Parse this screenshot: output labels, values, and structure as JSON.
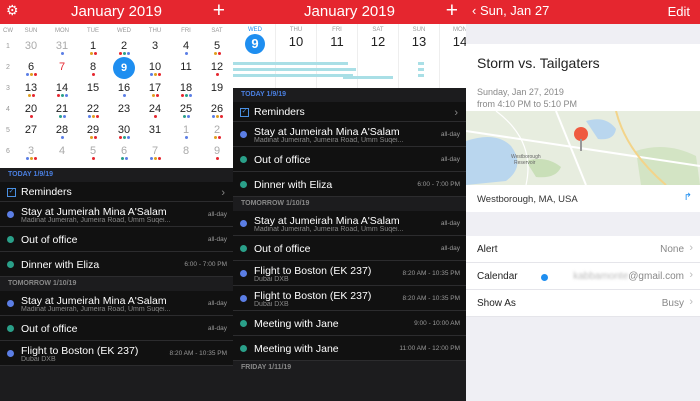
{
  "panel1": {
    "header": {
      "title": "January 2019",
      "settings_icon": "gear-icon",
      "add_icon": "plus-icon"
    },
    "weekday_headers": [
      "CW",
      "SUN",
      "MON",
      "TUE",
      "WED",
      "THU",
      "FRI",
      "SAT"
    ],
    "weeks": [
      {
        "cw": "1",
        "days": [
          "30",
          "31",
          "1",
          "2",
          "3",
          "4",
          "5"
        ]
      },
      {
        "cw": "2",
        "days": [
          "6",
          "7",
          "8",
          "9",
          "10",
          "11",
          "12"
        ]
      },
      {
        "cw": "3",
        "days": [
          "13",
          "14",
          "15",
          "16",
          "17",
          "18",
          "19"
        ]
      },
      {
        "cw": "4",
        "days": [
          "20",
          "21",
          "22",
          "23",
          "24",
          "25",
          "26"
        ]
      },
      {
        "cw": "5",
        "days": [
          "27",
          "28",
          "29",
          "30",
          "31",
          "1",
          "2"
        ]
      },
      {
        "cw": "6",
        "days": [
          "3",
          "4",
          "5",
          "6",
          "7",
          "8",
          "9"
        ]
      }
    ],
    "sections": [
      {
        "label": "TODAY 1/9/19",
        "items": [
          {
            "kind": "reminder",
            "title": "Reminders"
          },
          {
            "title": "Stay at Jumeirah Mina A'Salam",
            "sub": "Madinat Jumeirah, Jumeira Road, Umm Suqei...",
            "time": "all-day",
            "color": "#5b7ee5"
          },
          {
            "title": "Out of office",
            "sub": "",
            "time": "all-day",
            "color": "#2aa089"
          },
          {
            "title": "Dinner with Eliza",
            "sub": "",
            "time": "6:00 - 7:00 PM",
            "color": "#2aa089"
          }
        ]
      },
      {
        "label": "TOMORROW 1/10/19",
        "items": [
          {
            "title": "Stay at Jumeirah Mina A'Salam",
            "sub": "Madinat Jumeirah, Jumeira Road, Umm Suqei...",
            "time": "all-day",
            "color": "#5b7ee5"
          },
          {
            "title": "Out of office",
            "sub": "",
            "time": "all-day",
            "color": "#2aa089"
          },
          {
            "title": "Flight to Boston (EK 237)",
            "sub": "Dubai DXB",
            "time": "8:20 AM - 10:35 PM",
            "color": "#5b7ee5"
          }
        ]
      }
    ]
  },
  "panel2": {
    "header": {
      "title": "January 2019",
      "add_icon": "plus-icon"
    },
    "week_days": [
      {
        "wd": "WED",
        "n": "9"
      },
      {
        "wd": "THU",
        "n": "10"
      },
      {
        "wd": "FRI",
        "n": "11"
      },
      {
        "wd": "SAT",
        "n": "12"
      },
      {
        "wd": "SUN",
        "n": "13"
      },
      {
        "wd": "MON",
        "n": "14"
      }
    ],
    "sections": [
      {
        "label": "TODAY 1/9/19",
        "items": [
          {
            "kind": "reminder",
            "title": "Reminders"
          },
          {
            "title": "Stay at Jumeirah Mina A'Salam",
            "sub": "Madinat Jumeirah, Jumeira Road, Umm Suqei...",
            "time": "all-day",
            "color": "#5b7ee5"
          },
          {
            "title": "Out of office",
            "sub": "",
            "time": "all-day",
            "color": "#2aa089"
          },
          {
            "title": "Dinner with Eliza",
            "sub": "",
            "time": "6:00 - 7:00 PM",
            "color": "#2aa089"
          }
        ]
      },
      {
        "label": "TOMORROW 1/10/19",
        "items": [
          {
            "title": "Stay at Jumeirah Mina A'Salam",
            "sub": "Madinat Jumeirah, Jumeira Road, Umm Suqei...",
            "time": "all-day",
            "color": "#5b7ee5"
          },
          {
            "title": "Out of office",
            "sub": "",
            "time": "all-day",
            "color": "#2aa089"
          },
          {
            "title": "Flight to Boston (EK 237)",
            "sub": "Dubai DXB",
            "time": "8:20 AM - 10:35 PM",
            "color": "#5b7ee5"
          },
          {
            "title": "Flight to Boston (EK 237)",
            "sub": "Dubai DXB",
            "time": "8:20 AM - 10:35 PM",
            "color": "#5b7ee5"
          },
          {
            "title": "Meeting with Jane",
            "sub": "",
            "time": "9:00 - 10:00 AM",
            "color": "#2aa089"
          },
          {
            "title": "Meeting with Jane",
            "sub": "",
            "time": "11:00 AM - 12:00 PM",
            "color": "#2aa089"
          }
        ]
      },
      {
        "label": "FRIDAY 1/11/19",
        "items": []
      }
    ]
  },
  "panel3": {
    "header": {
      "back_label": "Sun, Jan 27",
      "edit_label": "Edit"
    },
    "title": "Storm vs. Tailgaters",
    "date_line": "Sunday, Jan 27, 2019",
    "time_line": "from 4:10 PM to 5:10 PM",
    "map_labels": {
      "reservoir": "Westborough Reservoir"
    },
    "location": "Westborough, MA, USA",
    "rows": [
      {
        "label": "Alert",
        "value": "None"
      },
      {
        "label": "Calendar",
        "value": "@gmail.com",
        "value_hidden": "kabbamonte"
      },
      {
        "label": "Show As",
        "value": "Busy"
      }
    ]
  }
}
